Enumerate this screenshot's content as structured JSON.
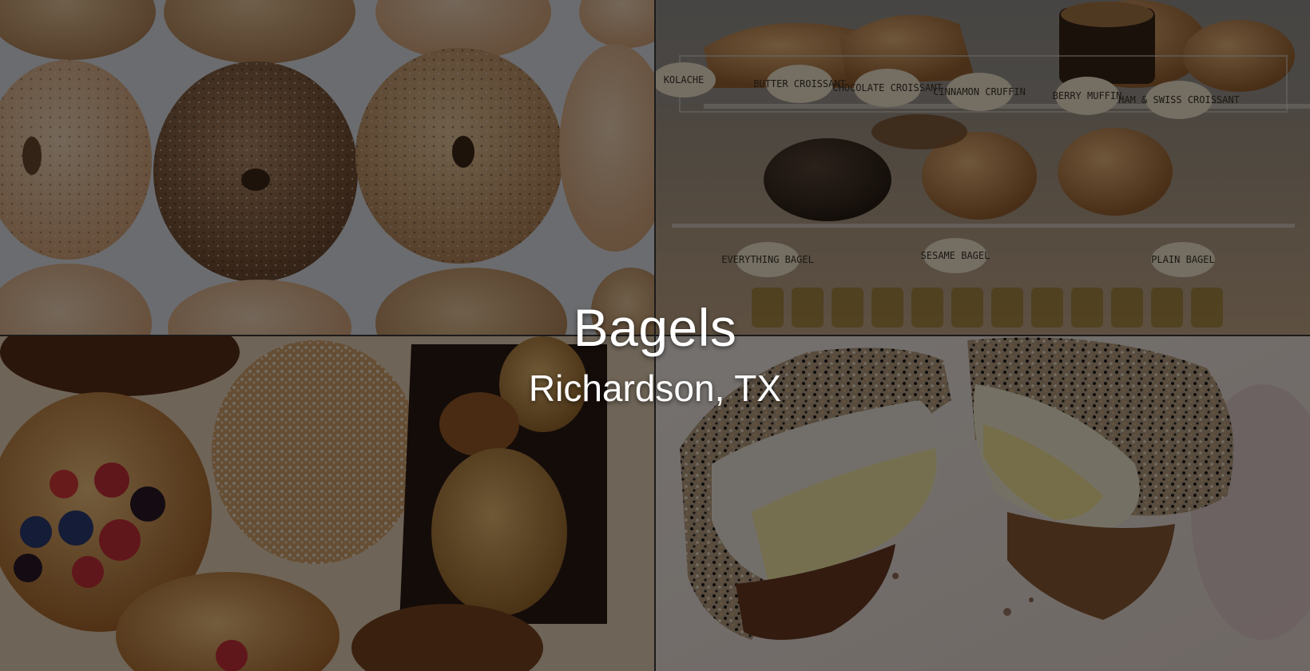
{
  "hero": {
    "title": "Bagels",
    "subtitle": "Richardson, TX"
  },
  "photos": {
    "top_left": "bagel-rows-photo",
    "top_right": "bakery-display-case-photo",
    "bottom_left": "pastries-photo",
    "bottom_right": "breakfast-bagel-sandwich-photo"
  },
  "display_case_tags": [
    "KOLACHE",
    "BUTTER CROISSANT",
    "CHOCOLATE CROISSANT",
    "CINNAMON CRUFFIN",
    "BERRY MUFFIN",
    "HAM & SWISS CROISSANT",
    "EVERYTHING BAGEL",
    "SESAME BAGEL",
    "PLAIN BAGEL"
  ],
  "colors": {
    "overlay": "rgba(0,0,0,0.52)",
    "text": "#ffffff"
  }
}
